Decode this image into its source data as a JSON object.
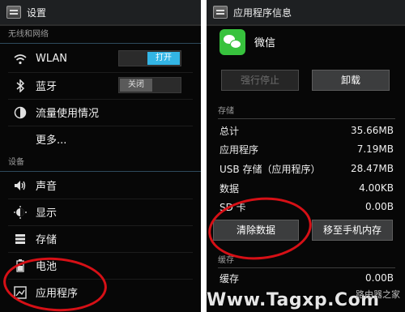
{
  "left": {
    "title": "设置",
    "section_wireless": "无线和网络",
    "wlan": {
      "label": "WLAN",
      "toggle": "打开"
    },
    "bluetooth": {
      "label": "蓝牙",
      "toggle": "关闭"
    },
    "data_usage": "流量使用情况",
    "more": "更多...",
    "section_device": "设备",
    "sound": "声音",
    "display": "显示",
    "storage": "存储",
    "battery": "电池",
    "apps": "应用程序"
  },
  "right": {
    "title": "应用程序信息",
    "app_name": "微信",
    "force_stop": "强行停止",
    "uninstall": "卸载",
    "section_storage": "存储",
    "rows": [
      {
        "label": "总计",
        "value": "35.66MB"
      },
      {
        "label": "应用程序",
        "value": "7.19MB"
      },
      {
        "label": "USB 存储（应用程序）",
        "value": "28.47MB"
      },
      {
        "label": "数据",
        "value": "4.00KB"
      },
      {
        "label": "SD 卡",
        "value": "0.00B"
      }
    ],
    "clear_data": "清除数据",
    "move_to_phone": "移至手机内存",
    "section_cache": "缓存",
    "cache_row": {
      "label": "缓存",
      "value": "0.00B"
    }
  },
  "watermark": {
    "text_main": "Www.Tagxp.Com",
    "text_cn": "路由器之家"
  },
  "colors": {
    "accent": "#33b5e5",
    "annotation": "#d61016",
    "wechat": "#37c23d"
  }
}
